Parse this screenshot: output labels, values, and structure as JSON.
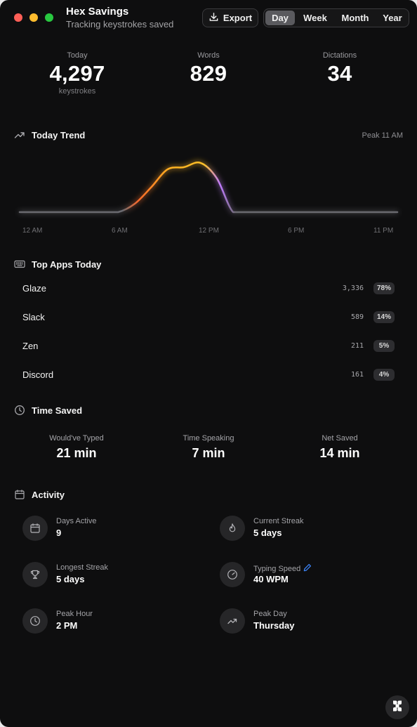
{
  "window": {
    "title": "Hex Savings",
    "subtitle": "Tracking keystrokes saved"
  },
  "toolbar": {
    "export_label": "Export",
    "periods": [
      "Day",
      "Week",
      "Month",
      "Year"
    ],
    "selected_period": "Day"
  },
  "stats": [
    {
      "label": "Today",
      "value": "4,297",
      "unit": "keystrokes"
    },
    {
      "label": "Words",
      "value": "829",
      "unit": ""
    },
    {
      "label": "Dictations",
      "value": "34",
      "unit": ""
    }
  ],
  "trend": {
    "title": "Today Trend",
    "icon": "trend-up-icon",
    "peak_label": "Peak 11 AM",
    "x_ticks": [
      "12 AM",
      "6 AM",
      "12 PM",
      "6 PM",
      "11 PM"
    ],
    "colors": {
      "baseline": "#6b6b6f",
      "warm": "#ffb020",
      "hot": "#ff6a2a",
      "cool": "#8f6bff"
    }
  },
  "chart_data": {
    "type": "line",
    "x": [
      0,
      1,
      2,
      3,
      4,
      5,
      6,
      7,
      8,
      9,
      10,
      11,
      12,
      13,
      14,
      15,
      16,
      17,
      18,
      19,
      20,
      21,
      22,
      23
    ],
    "series": [
      {
        "values": [
          0,
          0,
          0,
          0,
          0,
          0,
          0,
          0.15,
          0.45,
          0.78,
          0.82,
          0.9,
          0.62,
          0,
          0,
          0,
          0,
          0,
          0,
          0,
          0,
          0,
          0,
          0
        ]
      }
    ],
    "xlabels": [
      "12 AM",
      "6 AM",
      "12 PM",
      "6 PM",
      "11 PM"
    ],
    "grid": false
  },
  "top_apps": {
    "title": "Top Apps Today",
    "icon": "keyboard-icon",
    "items": [
      {
        "name": "Glaze",
        "count": "3,336",
        "pct": "78%"
      },
      {
        "name": "Slack",
        "count": "589",
        "pct": "14%"
      },
      {
        "name": "Zen",
        "count": "211",
        "pct": "5%"
      },
      {
        "name": "Discord",
        "count": "161",
        "pct": "4%"
      }
    ]
  },
  "time_saved": {
    "title": "Time Saved",
    "icon": "clock-icon",
    "items": [
      {
        "label": "Would've Typed",
        "value": "21 min"
      },
      {
        "label": "Time Speaking",
        "value": "7 min"
      },
      {
        "label": "Net Saved",
        "value": "14 min"
      }
    ]
  },
  "activity": {
    "title": "Activity",
    "icon": "calendar-icon",
    "items": [
      {
        "label": "Days Active",
        "value": "9",
        "icon": "calendar-icon"
      },
      {
        "label": "Current Streak",
        "value": "5 days",
        "icon": "flame-icon"
      },
      {
        "label": "Longest Streak",
        "value": "5 days",
        "icon": "trophy-icon"
      },
      {
        "label": "Typing Speed",
        "value": "40 WPM",
        "icon": "speedometer-icon",
        "editable": true
      },
      {
        "label": "Peak Hour",
        "value": "2 PM",
        "icon": "clock-icon"
      },
      {
        "label": "Peak Day",
        "value": "Thursday",
        "icon": "trend-up-icon"
      }
    ]
  },
  "floating_button": {
    "icon": "hex-logo-icon"
  }
}
